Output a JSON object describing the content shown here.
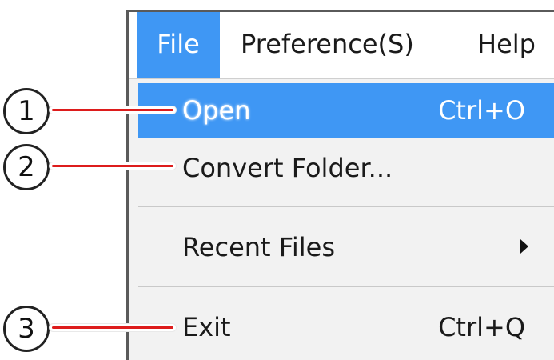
{
  "menubar": {
    "items": [
      {
        "label": "File"
      },
      {
        "label": "Preference(S)"
      },
      {
        "label": "Help"
      }
    ]
  },
  "file_menu": {
    "items": [
      {
        "label": "Open",
        "shortcut": "Ctrl+O",
        "highlighted": true
      },
      {
        "label": "Convert Folder...",
        "shortcut": ""
      },
      {
        "label": "Recent Files",
        "has_submenu": true
      },
      {
        "label": "Exit",
        "shortcut": "Ctrl+Q"
      }
    ]
  },
  "callouts": [
    {
      "number": "1"
    },
    {
      "number": "2"
    },
    {
      "number": "3"
    }
  ],
  "colors": {
    "highlight": "#3f97f4",
    "callout_line": "#dd1c1c",
    "menu_background": "#f2f2f2",
    "window_border": "#5a5a5a"
  }
}
